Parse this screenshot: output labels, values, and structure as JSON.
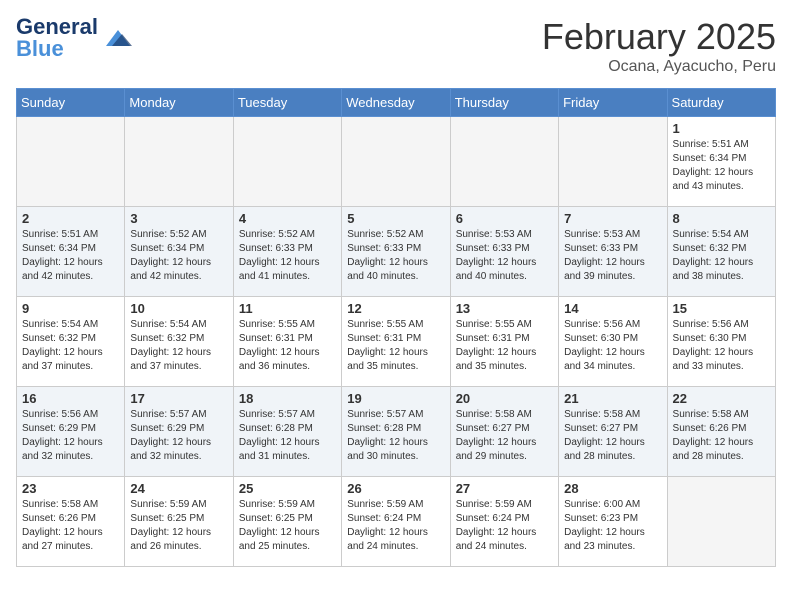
{
  "header": {
    "logo_general": "General",
    "logo_blue": "Blue",
    "month_title": "February 2025",
    "location": "Ocana, Ayacucho, Peru"
  },
  "weekdays": [
    "Sunday",
    "Monday",
    "Tuesday",
    "Wednesday",
    "Thursday",
    "Friday",
    "Saturday"
  ],
  "weeks": [
    [
      {
        "day": "",
        "info": ""
      },
      {
        "day": "",
        "info": ""
      },
      {
        "day": "",
        "info": ""
      },
      {
        "day": "",
        "info": ""
      },
      {
        "day": "",
        "info": ""
      },
      {
        "day": "",
        "info": ""
      },
      {
        "day": "1",
        "info": "Sunrise: 5:51 AM\nSunset: 6:34 PM\nDaylight: 12 hours\nand 43 minutes."
      }
    ],
    [
      {
        "day": "2",
        "info": "Sunrise: 5:51 AM\nSunset: 6:34 PM\nDaylight: 12 hours\nand 42 minutes."
      },
      {
        "day": "3",
        "info": "Sunrise: 5:52 AM\nSunset: 6:34 PM\nDaylight: 12 hours\nand 42 minutes."
      },
      {
        "day": "4",
        "info": "Sunrise: 5:52 AM\nSunset: 6:33 PM\nDaylight: 12 hours\nand 41 minutes."
      },
      {
        "day": "5",
        "info": "Sunrise: 5:52 AM\nSunset: 6:33 PM\nDaylight: 12 hours\nand 40 minutes."
      },
      {
        "day": "6",
        "info": "Sunrise: 5:53 AM\nSunset: 6:33 PM\nDaylight: 12 hours\nand 40 minutes."
      },
      {
        "day": "7",
        "info": "Sunrise: 5:53 AM\nSunset: 6:33 PM\nDaylight: 12 hours\nand 39 minutes."
      },
      {
        "day": "8",
        "info": "Sunrise: 5:54 AM\nSunset: 6:32 PM\nDaylight: 12 hours\nand 38 minutes."
      }
    ],
    [
      {
        "day": "9",
        "info": "Sunrise: 5:54 AM\nSunset: 6:32 PM\nDaylight: 12 hours\nand 37 minutes."
      },
      {
        "day": "10",
        "info": "Sunrise: 5:54 AM\nSunset: 6:32 PM\nDaylight: 12 hours\nand 37 minutes."
      },
      {
        "day": "11",
        "info": "Sunrise: 5:55 AM\nSunset: 6:31 PM\nDaylight: 12 hours\nand 36 minutes."
      },
      {
        "day": "12",
        "info": "Sunrise: 5:55 AM\nSunset: 6:31 PM\nDaylight: 12 hours\nand 35 minutes."
      },
      {
        "day": "13",
        "info": "Sunrise: 5:55 AM\nSunset: 6:31 PM\nDaylight: 12 hours\nand 35 minutes."
      },
      {
        "day": "14",
        "info": "Sunrise: 5:56 AM\nSunset: 6:30 PM\nDaylight: 12 hours\nand 34 minutes."
      },
      {
        "day": "15",
        "info": "Sunrise: 5:56 AM\nSunset: 6:30 PM\nDaylight: 12 hours\nand 33 minutes."
      }
    ],
    [
      {
        "day": "16",
        "info": "Sunrise: 5:56 AM\nSunset: 6:29 PM\nDaylight: 12 hours\nand 32 minutes."
      },
      {
        "day": "17",
        "info": "Sunrise: 5:57 AM\nSunset: 6:29 PM\nDaylight: 12 hours\nand 32 minutes."
      },
      {
        "day": "18",
        "info": "Sunrise: 5:57 AM\nSunset: 6:28 PM\nDaylight: 12 hours\nand 31 minutes."
      },
      {
        "day": "19",
        "info": "Sunrise: 5:57 AM\nSunset: 6:28 PM\nDaylight: 12 hours\nand 30 minutes."
      },
      {
        "day": "20",
        "info": "Sunrise: 5:58 AM\nSunset: 6:27 PM\nDaylight: 12 hours\nand 29 minutes."
      },
      {
        "day": "21",
        "info": "Sunrise: 5:58 AM\nSunset: 6:27 PM\nDaylight: 12 hours\nand 28 minutes."
      },
      {
        "day": "22",
        "info": "Sunrise: 5:58 AM\nSunset: 6:26 PM\nDaylight: 12 hours\nand 28 minutes."
      }
    ],
    [
      {
        "day": "23",
        "info": "Sunrise: 5:58 AM\nSunset: 6:26 PM\nDaylight: 12 hours\nand 27 minutes."
      },
      {
        "day": "24",
        "info": "Sunrise: 5:59 AM\nSunset: 6:25 PM\nDaylight: 12 hours\nand 26 minutes."
      },
      {
        "day": "25",
        "info": "Sunrise: 5:59 AM\nSunset: 6:25 PM\nDaylight: 12 hours\nand 25 minutes."
      },
      {
        "day": "26",
        "info": "Sunrise: 5:59 AM\nSunset: 6:24 PM\nDaylight: 12 hours\nand 24 minutes."
      },
      {
        "day": "27",
        "info": "Sunrise: 5:59 AM\nSunset: 6:24 PM\nDaylight: 12 hours\nand 24 minutes."
      },
      {
        "day": "28",
        "info": "Sunrise: 6:00 AM\nSunset: 6:23 PM\nDaylight: 12 hours\nand 23 minutes."
      },
      {
        "day": "",
        "info": ""
      }
    ]
  ]
}
